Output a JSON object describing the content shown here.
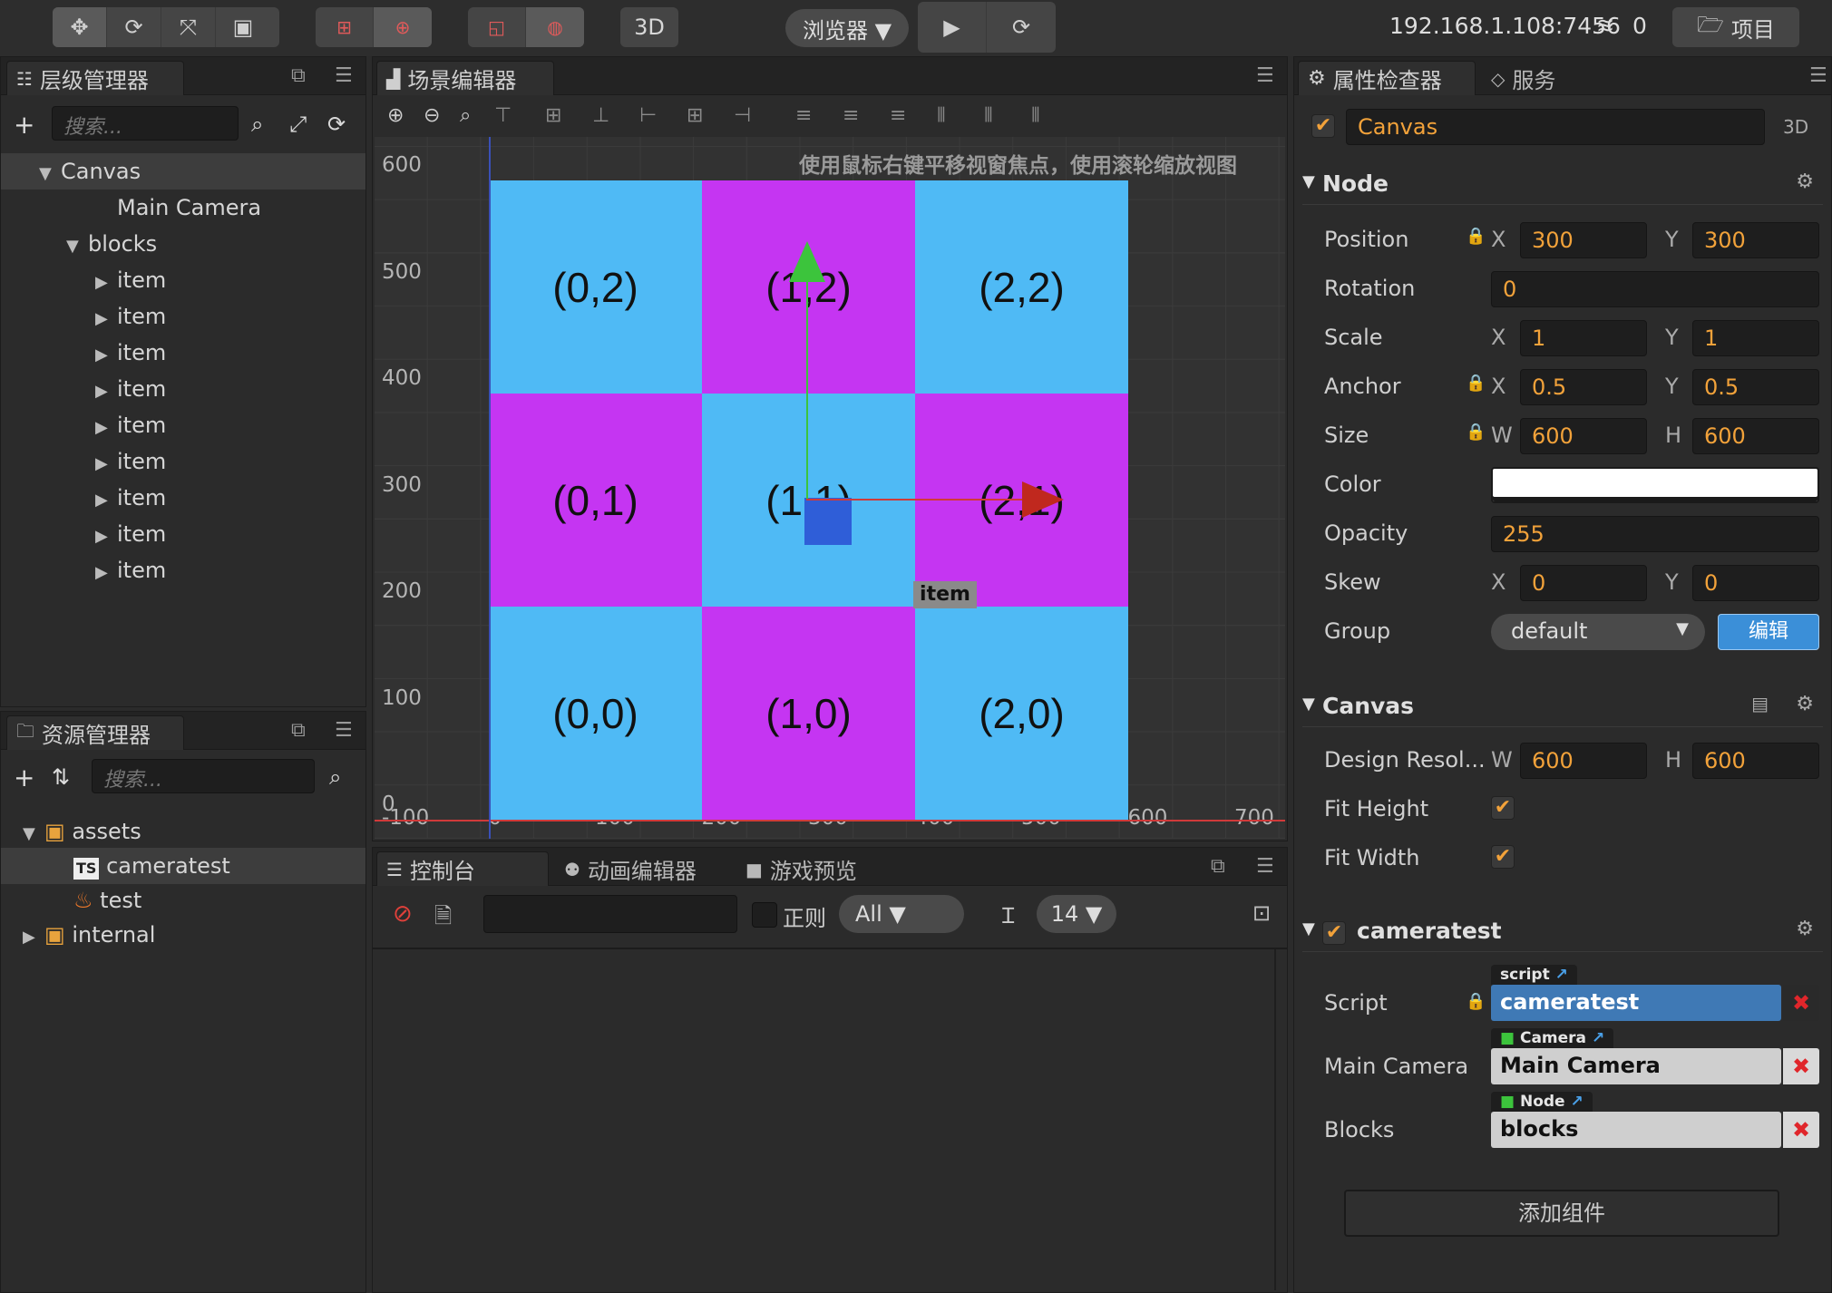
{
  "toolbar": {
    "transform_icons": [
      "move-icon",
      "rotate-icon",
      "scale-icon",
      "rect-icon"
    ],
    "pivot_icons": [
      "pivot-icon",
      "center-icon"
    ],
    "coord_icons": [
      "local-icon",
      "global-icon"
    ],
    "mode_3d": "3D",
    "preview_target": "浏览器 ▼",
    "play": "▶",
    "refresh": "⟳",
    "ip": "192.168.1.108:7456",
    "clients": "0",
    "project_button": "项目"
  },
  "hierarchy": {
    "title": "层级管理器",
    "search_placeholder": "搜索...",
    "nodes": [
      {
        "label": "Canvas",
        "arrow": "▼"
      },
      {
        "label": "Main Camera",
        "arrow": ""
      },
      {
        "label": "blocks",
        "arrow": "▼"
      },
      {
        "label": "item",
        "arrow": "▶"
      },
      {
        "label": "item",
        "arrow": "▶"
      },
      {
        "label": "item",
        "arrow": "▶"
      },
      {
        "label": "item",
        "arrow": "▶"
      },
      {
        "label": "item",
        "arrow": "▶"
      },
      {
        "label": "item",
        "arrow": "▶"
      },
      {
        "label": "item",
        "arrow": "▶"
      },
      {
        "label": "item",
        "arrow": "▶"
      },
      {
        "label": "item",
        "arrow": "▶"
      }
    ]
  },
  "assets": {
    "title": "资源管理器",
    "search_placeholder": "搜索...",
    "items": [
      {
        "label": "assets",
        "arrow": "▼"
      },
      {
        "label": "cameratest",
        "arrow": ""
      },
      {
        "label": "test",
        "arrow": ""
      },
      {
        "label": "internal",
        "arrow": "▶"
      }
    ],
    "ts_badge": "TS"
  },
  "scene": {
    "title": "场景编辑器",
    "hint": "使用鼠标右键平移视窗焦点，使用滚轮缩放视图",
    "y_ticks": [
      "600",
      "500",
      "400",
      "300",
      "200",
      "100",
      "0"
    ],
    "x_ticks": [
      "-100",
      "0",
      "100",
      "200",
      "300",
      "400",
      "500",
      "600",
      "700"
    ],
    "cells": [
      "(0,2)",
      "(1,2)",
      "(2,2)",
      "(0,1)",
      "(1,1)",
      "(2,1)",
      "(0,0)",
      "(1,0)",
      "(2,0)"
    ],
    "hover_label": "item",
    "colors": {
      "cyan": "#4fbaf5",
      "magenta": "#c535f2"
    }
  },
  "console": {
    "tabs": [
      "控制台",
      "动画编辑器",
      "游戏预览"
    ],
    "regex_label": "正则",
    "level": "All ▼",
    "font_size": "14 ▼"
  },
  "inspector": {
    "tabs": [
      "属性检查器",
      "服务"
    ],
    "node_name": "Canvas",
    "mode_label": "3D",
    "node_section": "Node",
    "props": {
      "position": {
        "label": "Position",
        "x": "300",
        "y": "300"
      },
      "rotation": {
        "label": "Rotation",
        "value": "0"
      },
      "scale": {
        "label": "Scale",
        "x": "1",
        "y": "1"
      },
      "anchor": {
        "label": "Anchor",
        "x": "0.5",
        "y": "0.5"
      },
      "size": {
        "label": "Size",
        "w": "600",
        "h": "600"
      },
      "color": {
        "label": "Color",
        "value": "#ffffff"
      },
      "opacity": {
        "label": "Opacity",
        "value": "255"
      },
      "skew": {
        "label": "Skew",
        "x": "0",
        "y": "0"
      },
      "group": {
        "label": "Group",
        "value": "default",
        "edit": "编辑"
      }
    },
    "axis": {
      "x": "X",
      "y": "Y",
      "w": "W",
      "h": "H"
    },
    "canvas_section": "Canvas",
    "design_res": {
      "label": "Design Resol...",
      "w": "600",
      "h": "600"
    },
    "fit_height": "Fit Height",
    "fit_width": "Fit Width",
    "script_section": "cameratest",
    "script": {
      "label": "Script",
      "tag": "script",
      "value": "cameratest"
    },
    "main_camera": {
      "label": "Main Camera",
      "tag": "Camera",
      "value": "Main Camera"
    },
    "blocks": {
      "label": "Blocks",
      "tag": "Node",
      "value": "blocks"
    },
    "add_component": "添加组件"
  }
}
